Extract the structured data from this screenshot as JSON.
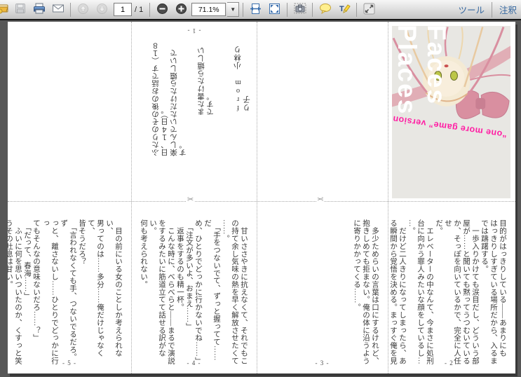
{
  "toolbar": {
    "page_current": "1",
    "page_total_label": "/ 1",
    "zoom_value": "71.1%",
    "tools_label": "ツール",
    "annotations_label": "注釈"
  },
  "booklet": {
    "cover": {
      "title": "Faces Places",
      "tagline": "“one more game” version"
    },
    "p1": {
      "footer": "- 1 -",
      "para1": "ふたりのその後のお話です（１８日、１４日）。\n楽しんでいただけたら嬉しいです。",
      "para2": "また書けたら嬉しいです。",
      "signature": "from 小林りり子"
    },
    "p2": {
      "footer": "- 2 -",
      "text": "目的がはっきりしている――あまりにも\nはっきりしすぎている場所だから、入るま\nでは躊躇する。\n　一歩入りかけても涙目だし、どういう部\n屋が……と聞いても黙ってうつむいている\nか、そっぽを向いているかで、完全に人任せ\nだ。\n　エレベーターの中なんて、今まさに処刑\n台に向かう罪人みたいな顔をしているし…\n…。\n　だけど二人きりになってしまったら、あ\nる瞬間から覚悟を決める。まっすぐ俺を見\nる。"
    },
    "p3": {
      "footer": "- 3 -",
      "text": "　多少ためらいの言葉は口にするけれど、\n抱きしめても拒まない。俺の体に沿うよう\nに寄りかかってくる……。"
    },
    "p4": {
      "footer": "- 4 -",
      "text": "　甘いささやきに抗えなくて、それでもこ\nの持て余し気味の熱を早く解放させたくて\n……。\n　「手をつないでて、ずっと握ってて……だ\nめ、ひとりでどっかに行かないでね……」\n　「注文が多いよ、おまえ……」\n　返事をするのも精一杯。\n　こんな時に、べらべらと――まるで演説\nをするみたいに筋道立てて話せる訳がない。\n何も考えられない。"
    },
    "p5": {
      "footer": "- 5 -",
      "text": "　目の前にいる女のことしか考えられない、\n男ってのは……多分……俺だけじゃなくて、\n皆そうだろ？\n　「言われなくても手、つないでるだろ。ず\nっと、離さないし……ひとりでどっかに行っ\nてもそんなの意味ないだろ……？」\n　「だって、春海……」\n　ふいに何を思いついたのか、くすっと笑\nうその吐息は甘い。\n　砂糖で出来た生き物みたいだ。"
    }
  }
}
